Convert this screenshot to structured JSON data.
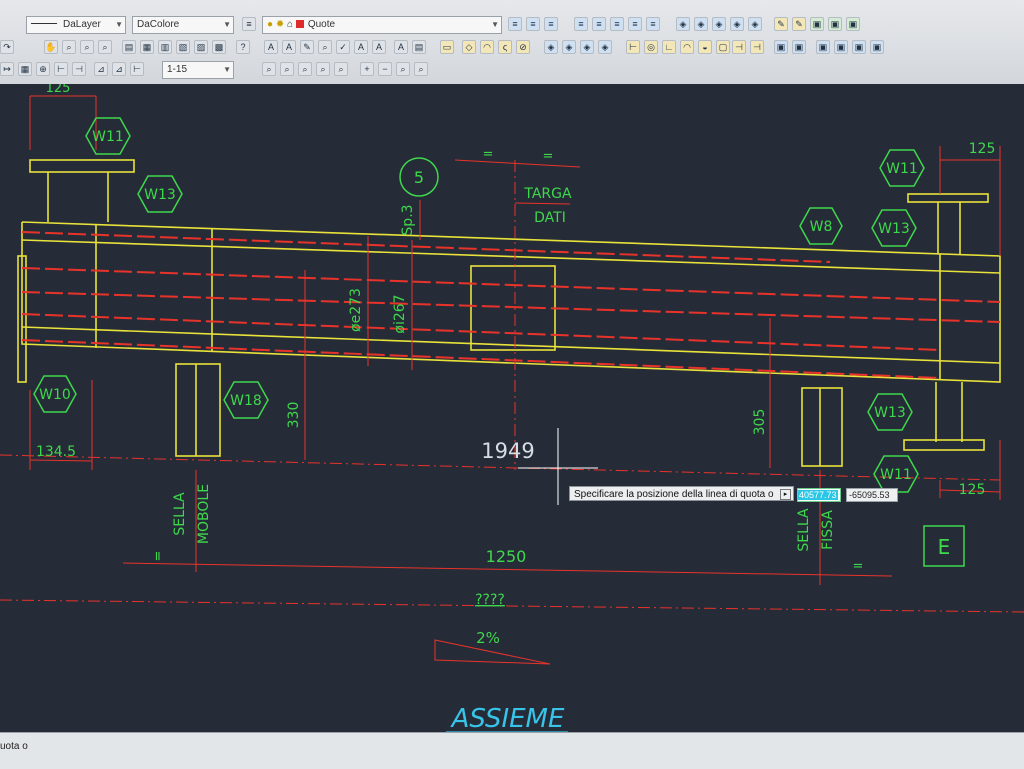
{
  "toolbar": {
    "linetype": "DaLayer",
    "color": "DaColore",
    "layer": "Quote",
    "scale": "1-15"
  },
  "drawing": {
    "balloons": {
      "w11_tl": "W11",
      "w13_l": "W13",
      "w10": "W10",
      "w18": "W18",
      "w11_tr": "W11",
      "w8": "W8",
      "w13_tr": "W13",
      "w13_br": "W13",
      "w11_br": "W11"
    },
    "item_number": "5",
    "sheet_letter": "E",
    "dims": {
      "top_left_125": "125",
      "top_right_125": "125",
      "bottom_right_125": "125",
      "d134": "134.5",
      "d1949": "1949",
      "d1250": "1250",
      "d330": "330",
      "d305": "305",
      "oe": "øe273",
      "oi": "øi267",
      "sp": "Sp.3",
      "eq1": "=",
      "eq2": "=",
      "eq3": "=",
      "eq4": "=",
      "unknown": "????",
      "slope": "2%"
    },
    "labels": {
      "targa": "TARGA",
      "dati": "DATI",
      "sella_mobole_1": "SELLA",
      "sella_mobole_2": "MOBOLE",
      "sella_fissa_1": "SELLA",
      "sella_fissa_2": "FISSA",
      "title": "ASSIEME"
    }
  },
  "prompt": {
    "text": "Specificare la posizione della linea di quota o",
    "x_value": "40577.73",
    "y_value": "-65095.53"
  },
  "command_line": {
    "text": "uota o"
  },
  "colors": {
    "background": "#262b38",
    "red": "#e8332a",
    "yellow": "#e8e23a",
    "green": "#3ed84c",
    "cyan": "#37c4e8"
  }
}
